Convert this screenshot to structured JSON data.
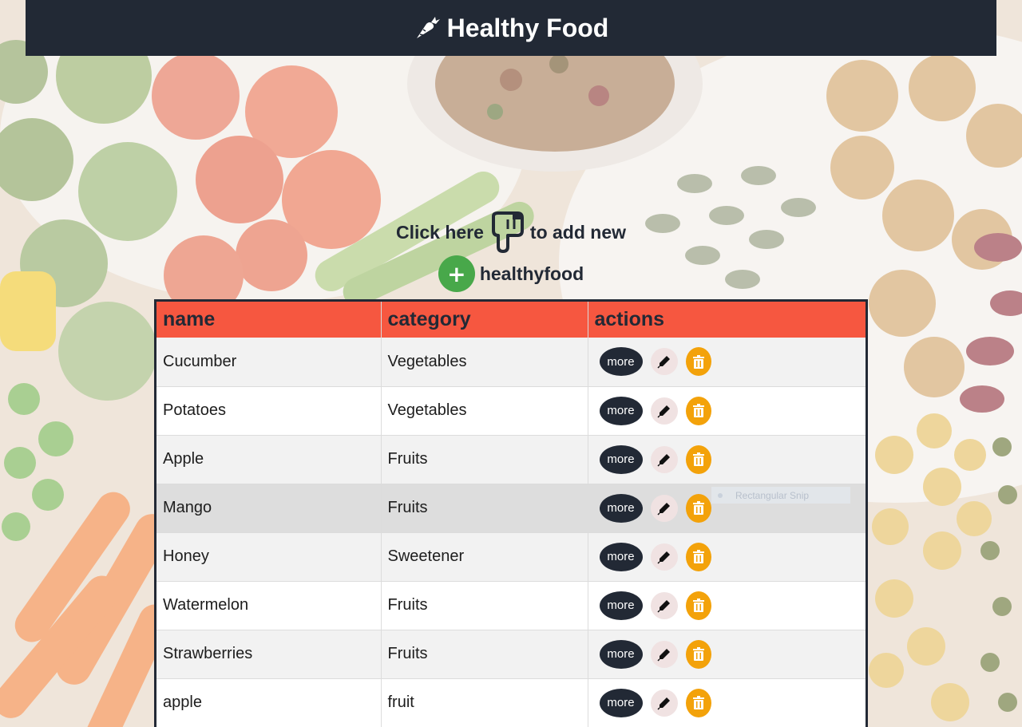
{
  "header": {
    "title": "Healthy Food",
    "icon": "carrot-icon"
  },
  "prompt": {
    "text_before": "Click here",
    "text_after": "to add new",
    "line2": "healthyfood",
    "hand_icon": "pointing-hand-down-icon",
    "add_button_label": "+"
  },
  "table": {
    "headers": [
      "name",
      "category",
      "actions"
    ],
    "more_label": "more",
    "rows": [
      {
        "name": "Cucumber",
        "category": "Vegetables"
      },
      {
        "name": "Potatoes",
        "category": "Vegetables"
      },
      {
        "name": "Apple",
        "category": "Fruits"
      },
      {
        "name": "Mango",
        "category": "Fruits"
      },
      {
        "name": "Honey",
        "category": "Sweetener"
      },
      {
        "name": "Watermelon",
        "category": "Fruits"
      },
      {
        "name": "Strawberries",
        "category": "Fruits"
      },
      {
        "name": "apple",
        "category": "fruit"
      }
    ]
  },
  "overlay": {
    "snip_label": "Rectangular Snip"
  },
  "colors": {
    "header_bg": "#222935",
    "table_header_bg": "#f65740",
    "add_button": "#48a84a",
    "delete_button": "#f3a20a",
    "edit_button": "#f0e2e2"
  }
}
